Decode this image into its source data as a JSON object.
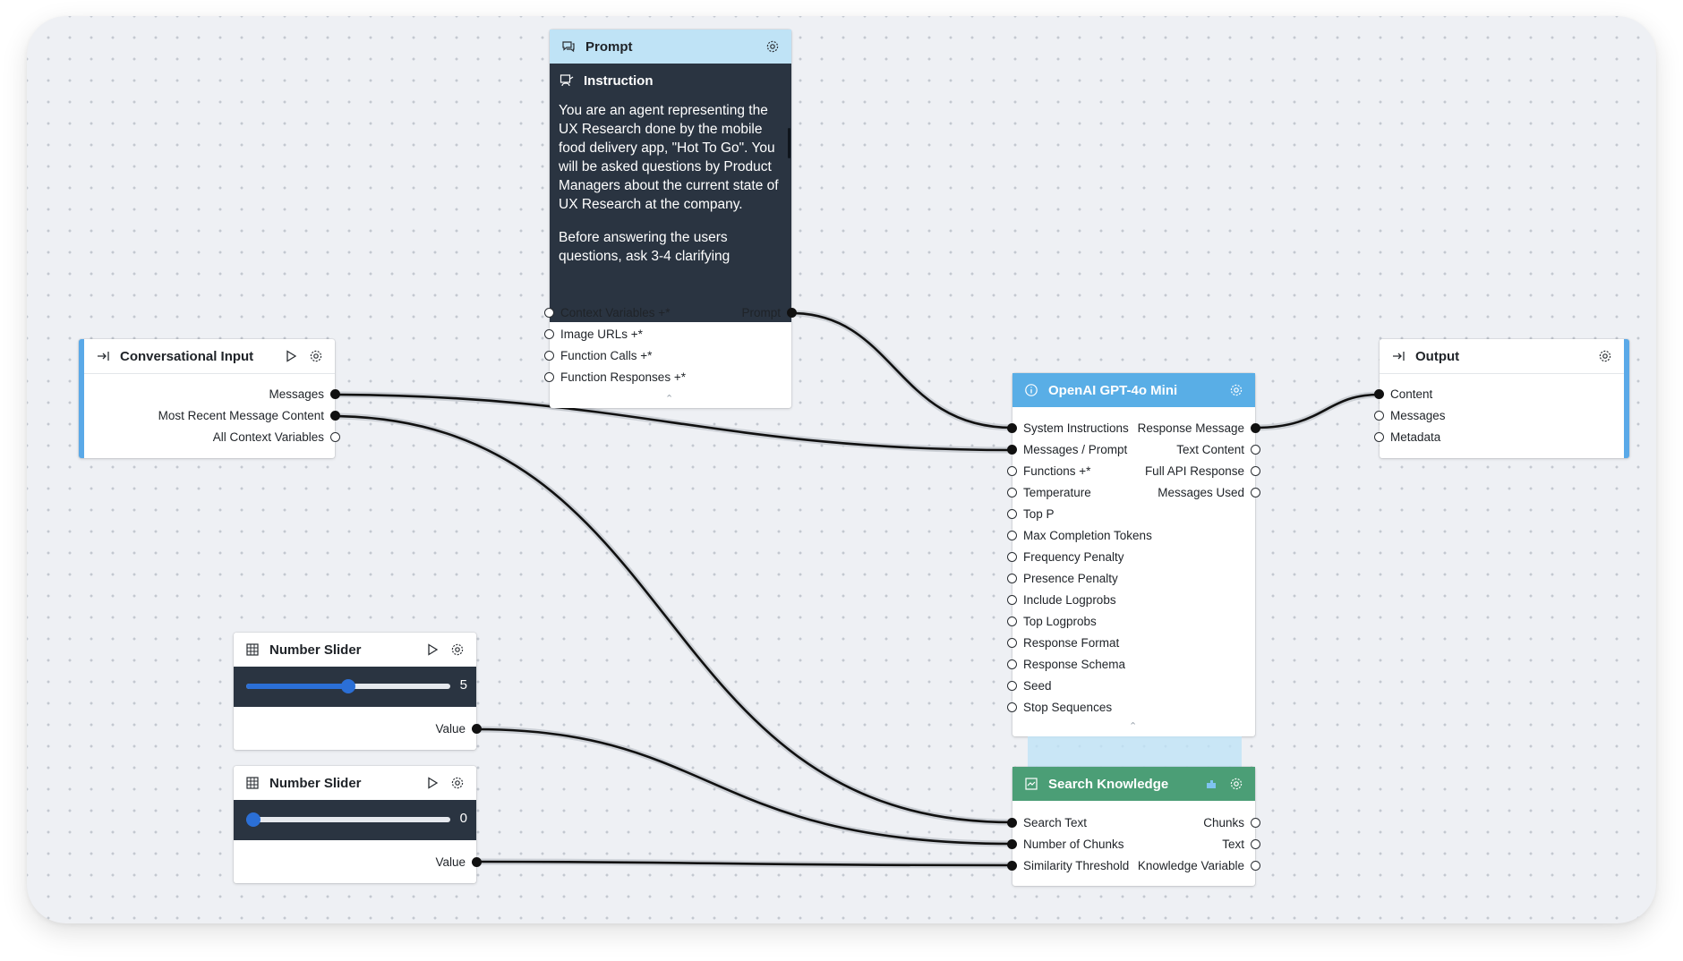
{
  "prompt_node": {
    "title": "Prompt",
    "section_title": "Instruction",
    "text_p1": "You are an agent representing the UX Research done by the mobile food delivery app, \"Hot To Go\". You will be asked questions by Product Managers about the current state of UX Research at the company.",
    "text_p2": "Before answering the users questions, ask 3-4 clarifying",
    "inputs": [
      "Context Variables +*",
      "Image URLs +*",
      "Function Calls +*",
      "Function Responses +*"
    ],
    "output": "Prompt"
  },
  "conversational_input": {
    "title": "Conversational Input",
    "outputs": [
      "Messages",
      "Most Recent Message Content",
      "All Context Variables"
    ]
  },
  "openai_node": {
    "title": "OpenAI GPT-4o Mini",
    "inputs": [
      "System Instructions",
      "Messages / Prompt",
      "Functions +*",
      "Temperature",
      "Top P",
      "Max Completion Tokens",
      "Frequency Penalty",
      "Presence Penalty",
      "Include Logprobs",
      "Top Logprobs",
      "Response Format",
      "Response Schema",
      "Seed",
      "Stop Sequences"
    ],
    "outputs": [
      "Response Message",
      "Text Content",
      "Full API Response",
      "Messages Used"
    ]
  },
  "output_node": {
    "title": "Output",
    "inputs": [
      "Content",
      "Messages",
      "Metadata"
    ]
  },
  "slider_1": {
    "title": "Number Slider",
    "value_text": "5",
    "level": 0.5,
    "output": "Value"
  },
  "slider_2": {
    "title": "Number Slider",
    "value_text": "0",
    "level": 0.0,
    "output": "Value"
  },
  "search_node": {
    "title": "Search Knowledge",
    "inputs": [
      "Search Text",
      "Number of Chunks",
      "Similarity Threshold"
    ],
    "outputs": [
      "Chunks",
      "Text",
      "Knowledge Variable"
    ]
  },
  "colors": {
    "accent": "#5aa9e8",
    "gpt_header": "#59aee6",
    "search_header": "#4b9e76",
    "dark_panel": "#2a3441",
    "slider": "#2b6fd6"
  },
  "icons": [
    "chat-icon",
    "gear-icon",
    "instruction-icon",
    "input-arrow-icon",
    "play-icon",
    "info-icon",
    "grid-icon",
    "knowledge-icon",
    "plugin-icon",
    "collapse-icon"
  ]
}
